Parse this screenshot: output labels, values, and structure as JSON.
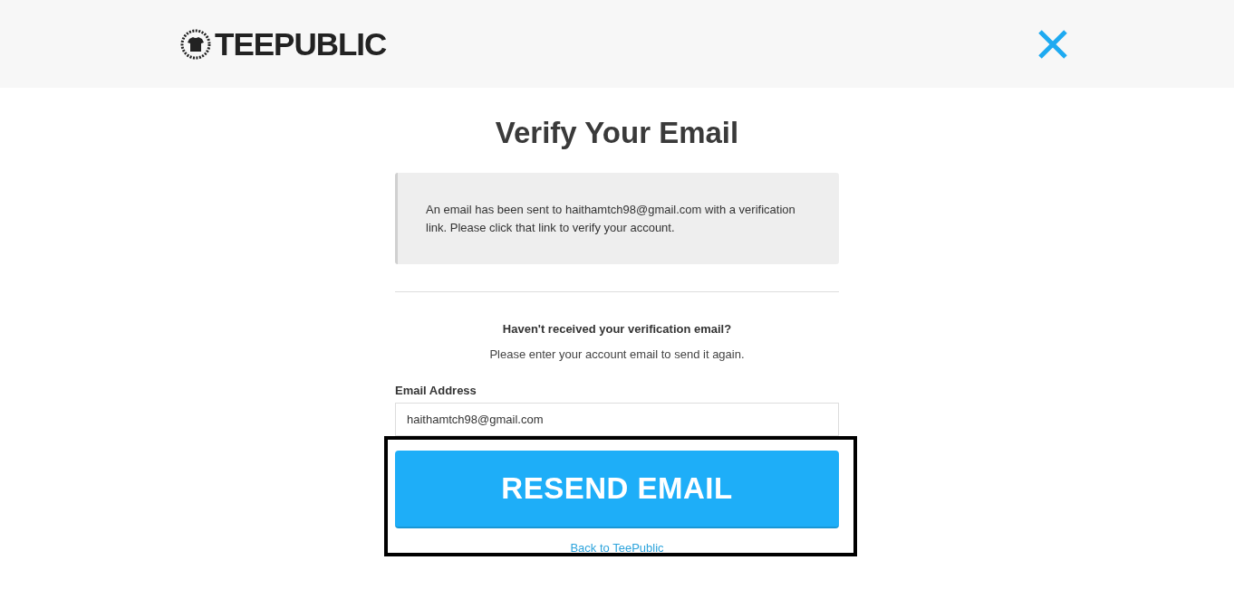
{
  "header": {
    "logo": "TEEPUBLIC"
  },
  "title": "Verify Your Email",
  "notice": "An email has been sent to haithamtch98@gmail.com with a verification link. Please click that link to verify your account.",
  "resend": {
    "heading": "Haven't received your verification email?",
    "instructions": "Please enter your account email to send it again.",
    "email_label": "Email Address",
    "email_value": "haithamtch98@gmail.com",
    "button": "RESEND EMAIL",
    "back_link": "Back to TeePublic"
  }
}
